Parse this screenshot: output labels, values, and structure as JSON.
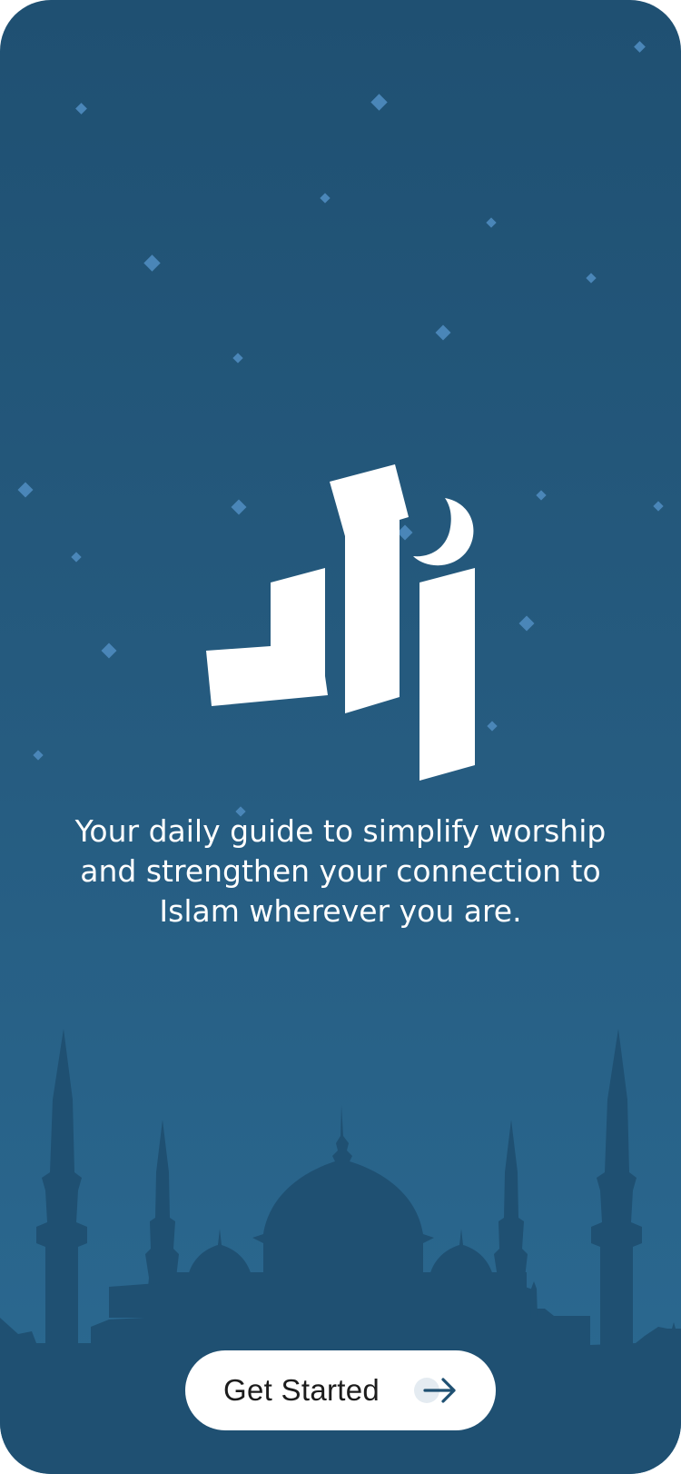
{
  "onboarding": {
    "tagline": "Your daily guide to simplify worship and strengthen your connection to Islam wherever you are.",
    "cta_label": "Get Started",
    "cta_icon": "arrow-right-icon",
    "logo_icon": "app-logo-crescent-icon",
    "background_art": "mosque-silhouette"
  },
  "colors": {
    "background_top": "#1f5072",
    "background_bottom": "#2b6a92",
    "silhouette": "#1f5072",
    "stars": "#4a86b8",
    "button": "#ffffff",
    "accent": "#1f5072"
  }
}
